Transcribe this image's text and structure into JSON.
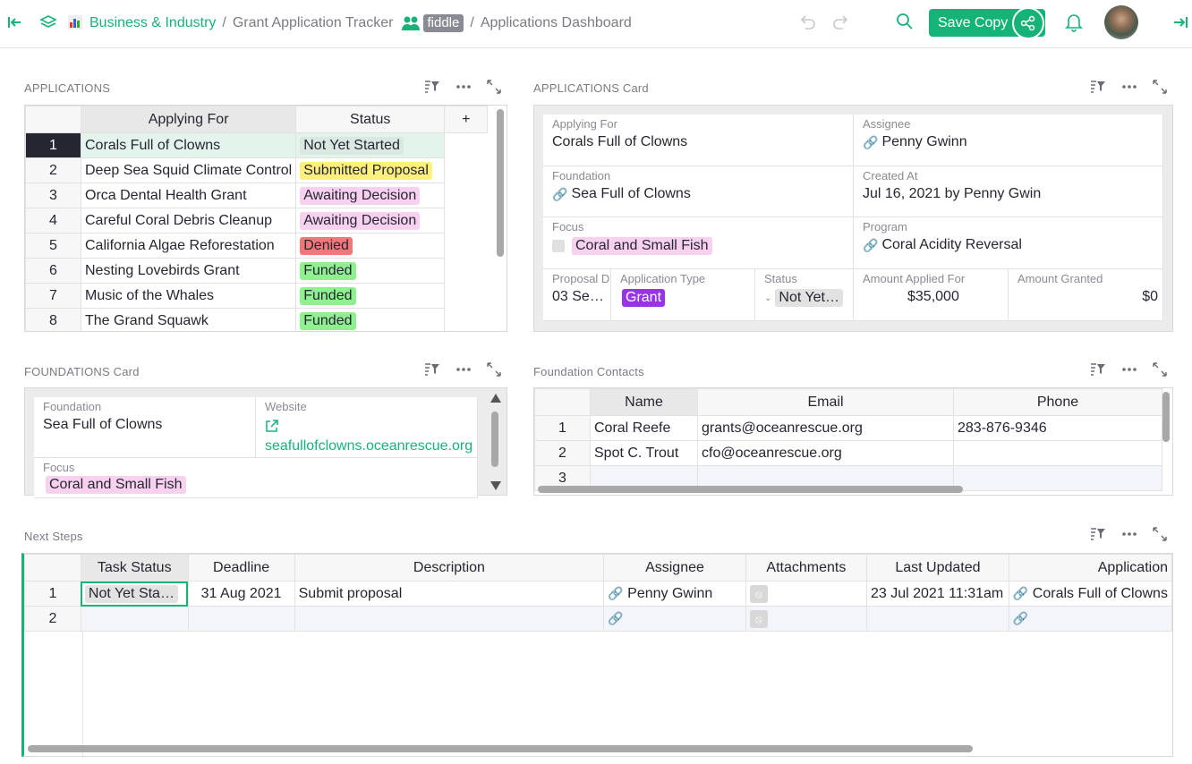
{
  "topbar": {
    "crumb_org": "Business & Industry",
    "crumb_doc": "Grant Application Tracker",
    "workspace_badge": "fiddle",
    "crumb_page": "Applications Dashboard",
    "save_copy": "Save Copy"
  },
  "applications": {
    "title": "APPLICATIONS",
    "columns": [
      "Applying For",
      "Status"
    ],
    "add_col": "+",
    "rows": [
      {
        "n": "1",
        "name": "Corals Full of Clowns",
        "status": "Not Yet Started",
        "color": "#d9e9e2"
      },
      {
        "n": "2",
        "name": "Deep Sea Squid Climate Control",
        "status": "Submitted Proposal",
        "color": "#fdf07c"
      },
      {
        "n": "3",
        "name": "Orca Dental Health Grant",
        "status": "Awaiting Decision",
        "color": "#f8d0f0"
      },
      {
        "n": "4",
        "name": "Careful Coral Debris Cleanup",
        "status": "Awaiting Decision",
        "color": "#f8d0f0"
      },
      {
        "n": "5",
        "name": "California Algae Reforestation",
        "status": "Denied",
        "color": "#f07878"
      },
      {
        "n": "6",
        "name": "Nesting Lovebirds Grant",
        "status": "Funded",
        "color": "#8ff08f"
      },
      {
        "n": "7",
        "name": "Music of the Whales",
        "status": "Funded",
        "color": "#8ff08f"
      },
      {
        "n": "8",
        "name": "The Grand Squawk",
        "status": "Funded",
        "color": "#8ff08f"
      }
    ]
  },
  "app_card": {
    "title": "APPLICATIONS Card",
    "applying_for_label": "Applying For",
    "applying_for": "Corals Full of Clowns",
    "assignee_label": "Assignee",
    "assignee": "Penny Gwinn",
    "foundation_label": "Foundation",
    "foundation": "Sea Full of Clowns",
    "created_label": "Created At",
    "created": "Jul 16, 2021 by Penny Gwin",
    "focus_label": "Focus",
    "focus": "Coral and Small Fish",
    "program_label": "Program",
    "program": "Coral Acidity Reversal",
    "proposal_label": "Proposal D",
    "proposal": "03 Se…",
    "apptype_label": "Application Type",
    "apptype": "Grant",
    "status_label": "Status",
    "status": "Not Yet…",
    "amount_applied_label": "Amount Applied For",
    "amount_applied": "$35,000",
    "amount_granted_label": "Amount Granted",
    "amount_granted": "$0"
  },
  "found_card": {
    "title": "FOUNDATIONS Card",
    "foundation_label": "Foundation",
    "foundation": "Sea Full of Clowns",
    "website_label": "Website",
    "website": "seafullofclowns.oceanrescue.org",
    "focus_label": "Focus",
    "focus": "Coral and Small Fish"
  },
  "contacts": {
    "title": "Foundation Contacts",
    "columns": [
      "Name",
      "Email",
      "Phone"
    ],
    "rows": [
      {
        "n": "1",
        "name": "Coral Reefe",
        "email": "grants@oceanrescue.org",
        "phone": "283-876-9346"
      },
      {
        "n": "2",
        "name": "Spot C. Trout",
        "email": "cfo@oceanrescue.org",
        "phone": ""
      },
      {
        "n": "3",
        "name": "",
        "email": "",
        "phone": ""
      }
    ]
  },
  "next_steps": {
    "title": "Next Steps",
    "columns": [
      "Task Status",
      "Deadline",
      "Description",
      "Assignee",
      "Attachments",
      "Last Updated",
      "Application"
    ],
    "rows": [
      {
        "n": "1",
        "task": "Not Yet Sta…",
        "deadline": "31 Aug 2021",
        "desc": "Submit proposal",
        "assignee": "Penny Gwinn",
        "updated": "23 Jul 2021 11:31am",
        "application": "Corals Full of Clowns"
      },
      {
        "n": "2",
        "task": "",
        "deadline": "",
        "desc": "",
        "assignee": "",
        "updated": "",
        "application": ""
      }
    ]
  },
  "colors": {
    "accent": "#16b378",
    "selected_row": "#262633"
  }
}
